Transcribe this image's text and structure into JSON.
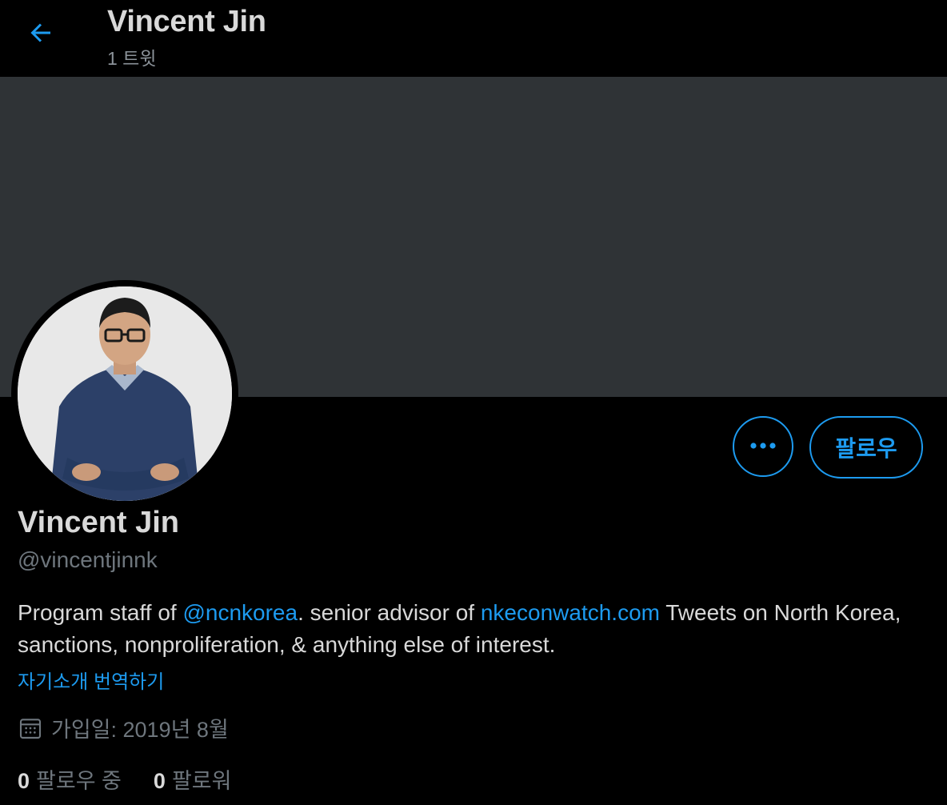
{
  "header": {
    "title": "Vincent Jin",
    "subtitle": "1 트윗"
  },
  "actions": {
    "follow_label": "팔로우"
  },
  "profile": {
    "name": "Vincent Jin",
    "handle": "@vincentjinnk",
    "bio": {
      "part1": "Program staff of ",
      "mention": "@ncnkorea",
      "part2": ". senior advisor of ",
      "url": "nkeconwatch.com",
      "part3": " Tweets on North Korea, sanctions, nonproliferation, & anything else of interest."
    },
    "translate_label": "자기소개 번역하기",
    "joined": "가입일: 2019년 8월",
    "following_count": "0",
    "following_label": "팔로우 중",
    "followers_count": "0",
    "followers_label": "팔로워"
  },
  "colors": {
    "accent": "#1d9bf0",
    "background": "#000000",
    "banner": "#2f3336",
    "secondary_text": "#6e767d"
  }
}
